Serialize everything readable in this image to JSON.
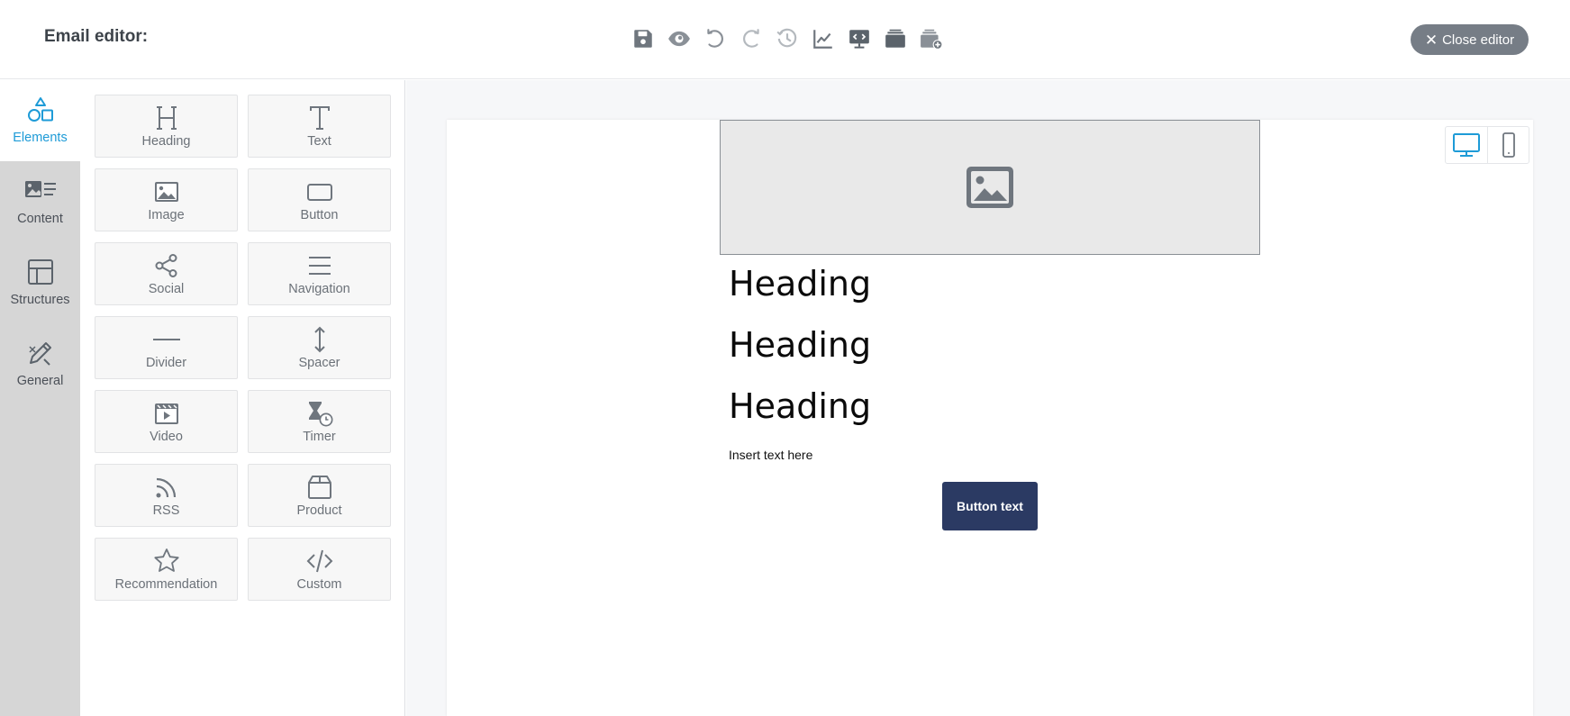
{
  "header": {
    "title": "Email editor:",
    "close_label": "Close editor",
    "close_glyph": "✕",
    "toolbar": [
      "save-icon",
      "preview-eye-icon",
      "undo-icon",
      "redo-icon",
      "history-icon",
      "stats-chart-icon",
      "code-monitor-icon",
      "stack-icon",
      "stack-add-icon"
    ]
  },
  "nav": {
    "items": [
      {
        "label": "Elements",
        "icon": "shapes-icon",
        "active": true
      },
      {
        "label": "Content",
        "icon": "content-icon",
        "active": false
      },
      {
        "label": "Structures",
        "icon": "structures-icon",
        "active": false
      },
      {
        "label": "General",
        "icon": "general-icon",
        "active": false
      }
    ]
  },
  "elements": {
    "tiles": [
      {
        "label": "Heading",
        "icon": "heading-icon"
      },
      {
        "label": "Text",
        "icon": "text-icon"
      },
      {
        "label": "Image",
        "icon": "image-icon"
      },
      {
        "label": "Button",
        "icon": "button-icon"
      },
      {
        "label": "Social",
        "icon": "share-icon"
      },
      {
        "label": "Navigation",
        "icon": "menu-icon"
      },
      {
        "label": "Divider",
        "icon": "divider-icon"
      },
      {
        "label": "Spacer",
        "icon": "spacer-icon"
      },
      {
        "label": "Video",
        "icon": "video-icon"
      },
      {
        "label": "Timer",
        "icon": "timer-icon"
      },
      {
        "label": "RSS",
        "icon": "rss-icon"
      },
      {
        "label": "Product",
        "icon": "product-icon"
      },
      {
        "label": "Recommendation",
        "icon": "star-icon"
      },
      {
        "label": "Custom",
        "icon": "code-icon"
      }
    ]
  },
  "canvas": {
    "headings": [
      "Heading",
      "Heading",
      "Heading"
    ],
    "body_text": "Insert text here",
    "button_text": "Button text"
  },
  "colors": {
    "accent": "#1e9bd7",
    "cta": "#2b3a63",
    "close_button": "#767d86",
    "icon_gray": "#767d86"
  }
}
